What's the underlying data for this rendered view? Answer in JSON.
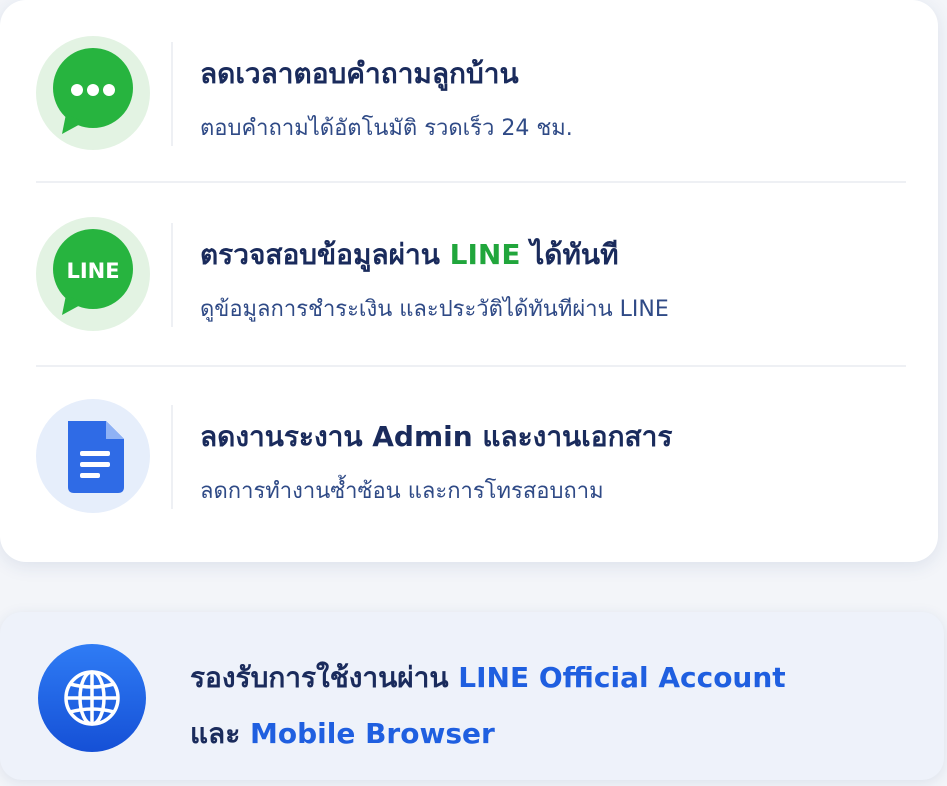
{
  "features": [
    {
      "icon": "chat-bubble-icon",
      "title": "ลดเวลาตอบคำถามลูกบ้าน",
      "description": "ตอบคำถามได้อัตโนมัติ รวดเร็ว 24 ชม."
    },
    {
      "icon": "line-logo-icon",
      "icon_text": "LINE",
      "title_prefix": "ตรวจสอบข้อมูลผ่าน ",
      "title_highlight": "LINE",
      "title_suffix": " ได้ทันที",
      "description": "ดูข้อมูลการชำระเงิน และประวัติได้ทันทีผ่าน LINE"
    },
    {
      "icon": "document-icon",
      "title": "ลดงานระงาน Admin และงานเอกสาร",
      "description": "ลดการทำงานซ้ำซ้อน และการโทรสอบถาม"
    }
  ],
  "banner": {
    "icon": "globe-icon",
    "line1_prefix": "รองรับการใช้งานผ่าน ",
    "line1_highlight": "LINE Official Account",
    "line2_prefix": "และ ",
    "line2_highlight": "Mobile Browser"
  },
  "colors": {
    "title": "#1a2b5c",
    "description": "#2f4a86",
    "line_green": "#21a63c",
    "accent_blue": "#1f5fe0"
  }
}
